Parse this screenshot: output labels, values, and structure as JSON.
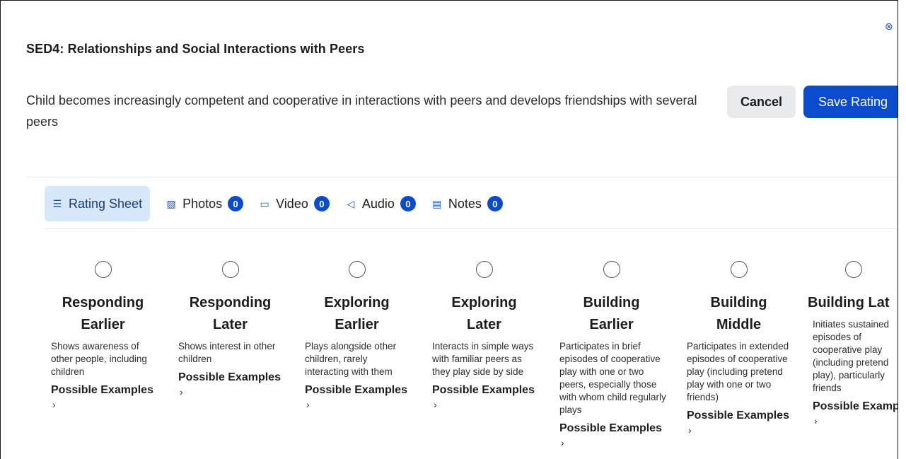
{
  "modal": {
    "title": "SED4: Relationships and Social Interactions with Peers",
    "description": "Child becomes increasingly competent and cooperative in interactions with peers and develops friendships with several peers",
    "cancel_label": "Cancel",
    "save_label": "Save Rating",
    "close_icon": "close-circle-icon"
  },
  "tabs": [
    {
      "label": "Rating Sheet",
      "icon": "list-icon",
      "active": true
    },
    {
      "label": "Photos",
      "icon": "photo-icon",
      "count": "0"
    },
    {
      "label": "Video",
      "icon": "video-icon",
      "count": "0"
    },
    {
      "label": "Audio",
      "icon": "speaker-icon",
      "count": "0"
    },
    {
      "label": "Notes",
      "icon": "notes-icon",
      "count": "0"
    }
  ],
  "levels": [
    {
      "name_line1": "Responding",
      "name_line2": "Earlier",
      "description": "Shows awareness of other people, including children",
      "examples_label": "Possible Examples"
    },
    {
      "name_line1": "Responding",
      "name_line2": "Later",
      "description": "Shows interest in other children",
      "examples_label": "Possible Examples"
    },
    {
      "name_line1": "Exploring",
      "name_line2": "Earlier",
      "description": "Plays alongside other children, rarely interacting with them",
      "examples_label": "Possible Examples"
    },
    {
      "name_line1": "Exploring",
      "name_line2": "Later",
      "description": "Interacts in simple ways with familiar peers as they play side by side",
      "examples_label": "Possible Examples"
    },
    {
      "name_line1": "Building",
      "name_line2": "Earlier",
      "description": "Participates in brief episodes of cooperative play with one or two peers, especially those with whom child regularly plays",
      "examples_label": "Possible Examples"
    },
    {
      "name_line1": "Building",
      "name_line2": "Middle",
      "description": "Participates in extended episodes of cooperative play (including pretend play with one or two friends)",
      "examples_label": "Possible Examples"
    },
    {
      "name_line1": "Building Lat",
      "name_line2": "",
      "description": "Initiates sustained episodes of cooperative play (including pretend play), particularly friends",
      "examples_label": "Possible Examp"
    }
  ],
  "chevron": "›",
  "colors": {
    "primary": "#0b4ccf",
    "active_tab_bg": "#d7e8fb",
    "cancel_bg": "#e9eaec"
  }
}
